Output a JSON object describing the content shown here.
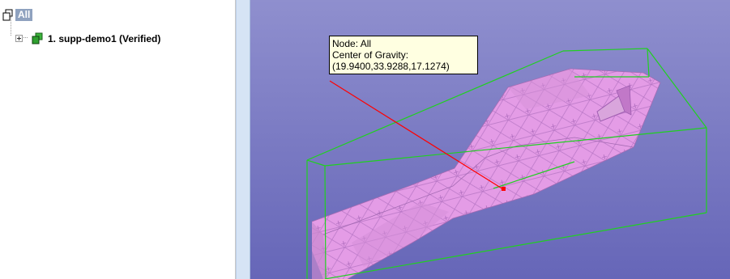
{
  "tree": {
    "root_label": "All",
    "items": [
      {
        "label": "1. supp-demo1 (Verified)"
      }
    ]
  },
  "viewport": {
    "tooltip": {
      "line1": "Node: All",
      "line2": "Center of Gravity:",
      "line3": "(19.9400,33.9288,17.1274)"
    }
  },
  "colors": {
    "viewport_top": "#8f8fce",
    "viewport_bottom": "#6666b8",
    "mesh_fill": "#e49ce6",
    "mesh_edge": "#b675c4",
    "bounding_box": "#20d020",
    "leader_line": "#ff0000",
    "tooltip_bg": "#ffffe1"
  }
}
